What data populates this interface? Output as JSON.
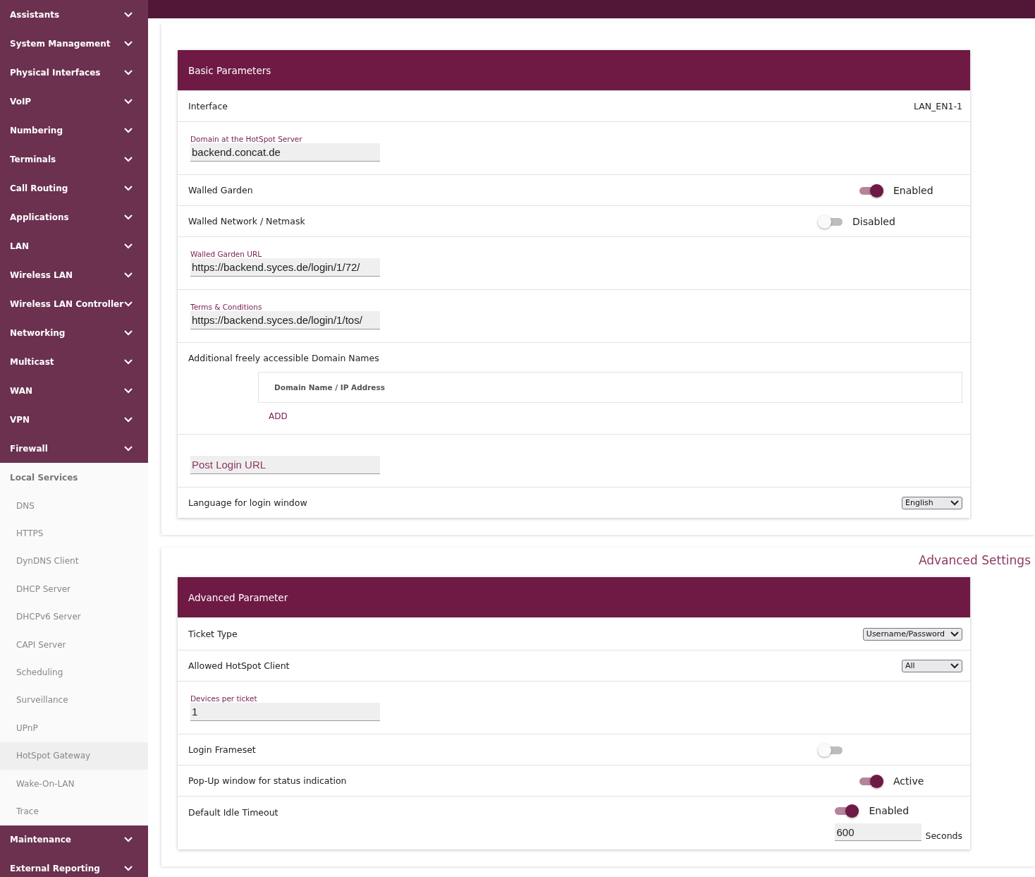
{
  "sidebar": {
    "sections": [
      {
        "label": "Assistants",
        "expanded": false
      },
      {
        "label": "System Management",
        "expanded": false
      },
      {
        "label": "Physical Interfaces",
        "expanded": false
      },
      {
        "label": "VoIP",
        "expanded": false
      },
      {
        "label": "Numbering",
        "expanded": false
      },
      {
        "label": "Terminals",
        "expanded": false
      },
      {
        "label": "Call Routing",
        "expanded": false
      },
      {
        "label": "Applications",
        "expanded": false
      },
      {
        "label": "LAN",
        "expanded": false
      },
      {
        "label": "Wireless LAN",
        "expanded": false
      },
      {
        "label": "Wireless LAN Controller",
        "expanded": false
      },
      {
        "label": "Networking",
        "expanded": false
      },
      {
        "label": "Multicast",
        "expanded": false
      },
      {
        "label": "WAN",
        "expanded": false
      },
      {
        "label": "VPN",
        "expanded": false
      },
      {
        "label": "Firewall",
        "expanded": false
      },
      {
        "label": "Local Services",
        "expanded": true,
        "items": [
          {
            "label": "DNS",
            "selected": false
          },
          {
            "label": "HTTPS",
            "selected": false
          },
          {
            "label": "DynDNS Client",
            "selected": false
          },
          {
            "label": "DHCP Server",
            "selected": false
          },
          {
            "label": "DHCPv6 Server",
            "selected": false
          },
          {
            "label": "CAPI Server",
            "selected": false
          },
          {
            "label": "Scheduling",
            "selected": false
          },
          {
            "label": "Surveillance",
            "selected": false
          },
          {
            "label": "UPnP",
            "selected": false
          },
          {
            "label": "HotSpot Gateway",
            "selected": true
          },
          {
            "label": "Wake-On-LAN",
            "selected": false
          },
          {
            "label": "Trace",
            "selected": false
          }
        ]
      },
      {
        "label": "Maintenance",
        "expanded": false
      },
      {
        "label": "External Reporting",
        "expanded": false
      }
    ]
  },
  "blocks": [
    {
      "panel": {
        "title": "Basic Parameters",
        "rows": [
          {
            "kind": "text",
            "label": "Interface",
            "value": "LAN_EN1-1"
          },
          {
            "kind": "field",
            "label": "Domain at the HotSpot Server",
            "value": "backend.concat.de"
          },
          {
            "kind": "toggle",
            "label": "Walled Garden",
            "on": true,
            "state_label": "Enabled"
          },
          {
            "kind": "toggle",
            "label": "Walled Network / Netmask",
            "on": false,
            "state_label": "Disabled"
          },
          {
            "kind": "field",
            "label": "Walled Garden URL",
            "value": "https://backend.syces.de/login/1/72/"
          },
          {
            "kind": "field",
            "label": "Terms & Conditions",
            "value": "https://backend.syces.de/login/1/tos/"
          },
          {
            "kind": "list",
            "label": "Additional freely accessible Domain Names",
            "column": "Domain Name / IP Address",
            "add": "ADD"
          },
          {
            "kind": "field",
            "placeholder": "Post Login URL"
          },
          {
            "kind": "select",
            "label": "Language for login window",
            "value": "English"
          }
        ]
      }
    },
    {
      "link": "Advanced Settings",
      "panel": {
        "title": "Advanced Parameter",
        "rows": [
          {
            "kind": "select",
            "label": "Ticket Type",
            "value": "Username/Password"
          },
          {
            "kind": "select",
            "label": "Allowed HotSpot Client",
            "value": "All"
          },
          {
            "kind": "field",
            "label": "Devices per ticket",
            "value": "1"
          },
          {
            "kind": "toggle",
            "label": "Login Frameset",
            "on": false
          },
          {
            "kind": "toggle",
            "label": "Pop-Up window for status indication",
            "on": true,
            "state_label": "Active"
          },
          {
            "kind": "toggle_field",
            "label": "Default Idle Timeout",
            "on": true,
            "state_label": "Enabled",
            "value": "600",
            "unit": "Seconds"
          }
        ]
      }
    }
  ]
}
